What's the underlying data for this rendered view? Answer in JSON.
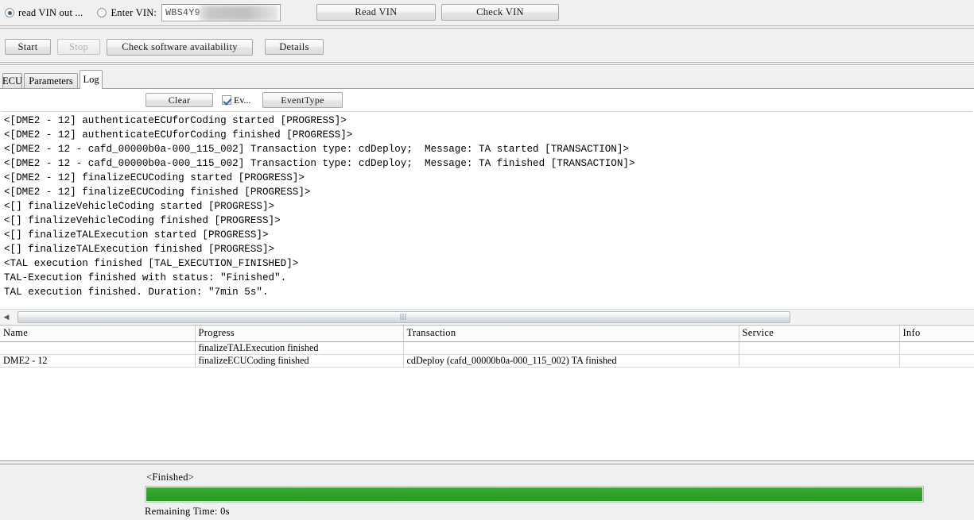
{
  "vin_bar": {
    "read_vin_radio_label": "read VIN out ...",
    "read_vin_radio_selected": true,
    "enter_vin_radio_label": "Enter VIN:",
    "enter_vin_radio_selected": false,
    "vin_value": "WBS4Y9",
    "read_vin_button": "Read VIN",
    "check_vin_button": "Check VIN"
  },
  "toolbar": {
    "start": "Start",
    "stop": "Stop",
    "stop_disabled": true,
    "check_software_availability": "Check software availability",
    "details": "Details"
  },
  "tabs": {
    "items": [
      {
        "label": "ECU",
        "active": false
      },
      {
        "label": "Parameters",
        "active": false
      },
      {
        "label": "Log",
        "active": true
      }
    ]
  },
  "log_controls": {
    "clear_button": "Clear",
    "event_checkbox_label": "Ev...",
    "event_checkbox_checked": true,
    "event_type_button": "EventType"
  },
  "log": {
    "lines": [
      "<[DME2 - 12] authenticateECUforCoding started [PROGRESS]>",
      "<[DME2 - 12] authenticateECUforCoding finished [PROGRESS]>",
      "<[DME2 - 12 - cafd_00000b0a-000_115_002] Transaction type: cdDeploy;  Message: TA started [TRANSACTION]>",
      "<[DME2 - 12 - cafd_00000b0a-000_115_002] Transaction type: cdDeploy;  Message: TA finished [TRANSACTION]>",
      "<[DME2 - 12] finalizeECUCoding started [PROGRESS]>",
      "<[DME2 - 12] finalizeECUCoding finished [PROGRESS]>",
      "<[] finalizeVehicleCoding started [PROGRESS]>",
      "<[] finalizeVehicleCoding finished [PROGRESS]>",
      "<[] finalizeTALExecution started [PROGRESS]>",
      "<[] finalizeTALExecution finished [PROGRESS]>",
      "<TAL execution finished [TAL_EXECUTION_FINISHED]>",
      "TAL-Execution finished with status: \"Finished\".",
      "TAL execution finished. Duration: \"7min 5s\"."
    ]
  },
  "table": {
    "headers": [
      "Name",
      "Progress",
      "Transaction",
      "Service",
      "Info"
    ],
    "rows": [
      {
        "name": "",
        "progress": "finalizeTALExecution finished",
        "transaction": "",
        "service": "",
        "info": ""
      },
      {
        "name": "DME2 - 12",
        "progress": "finalizeECUCoding finished",
        "transaction": "cdDeploy (cafd_00000b0a-000_115_002) TA finished",
        "service": "",
        "info": ""
      }
    ]
  },
  "footer": {
    "status": "<Finished>",
    "progress_percent": 100,
    "progress_color": "#2ea327",
    "remaining_time": "Remaining Time:  0s"
  }
}
